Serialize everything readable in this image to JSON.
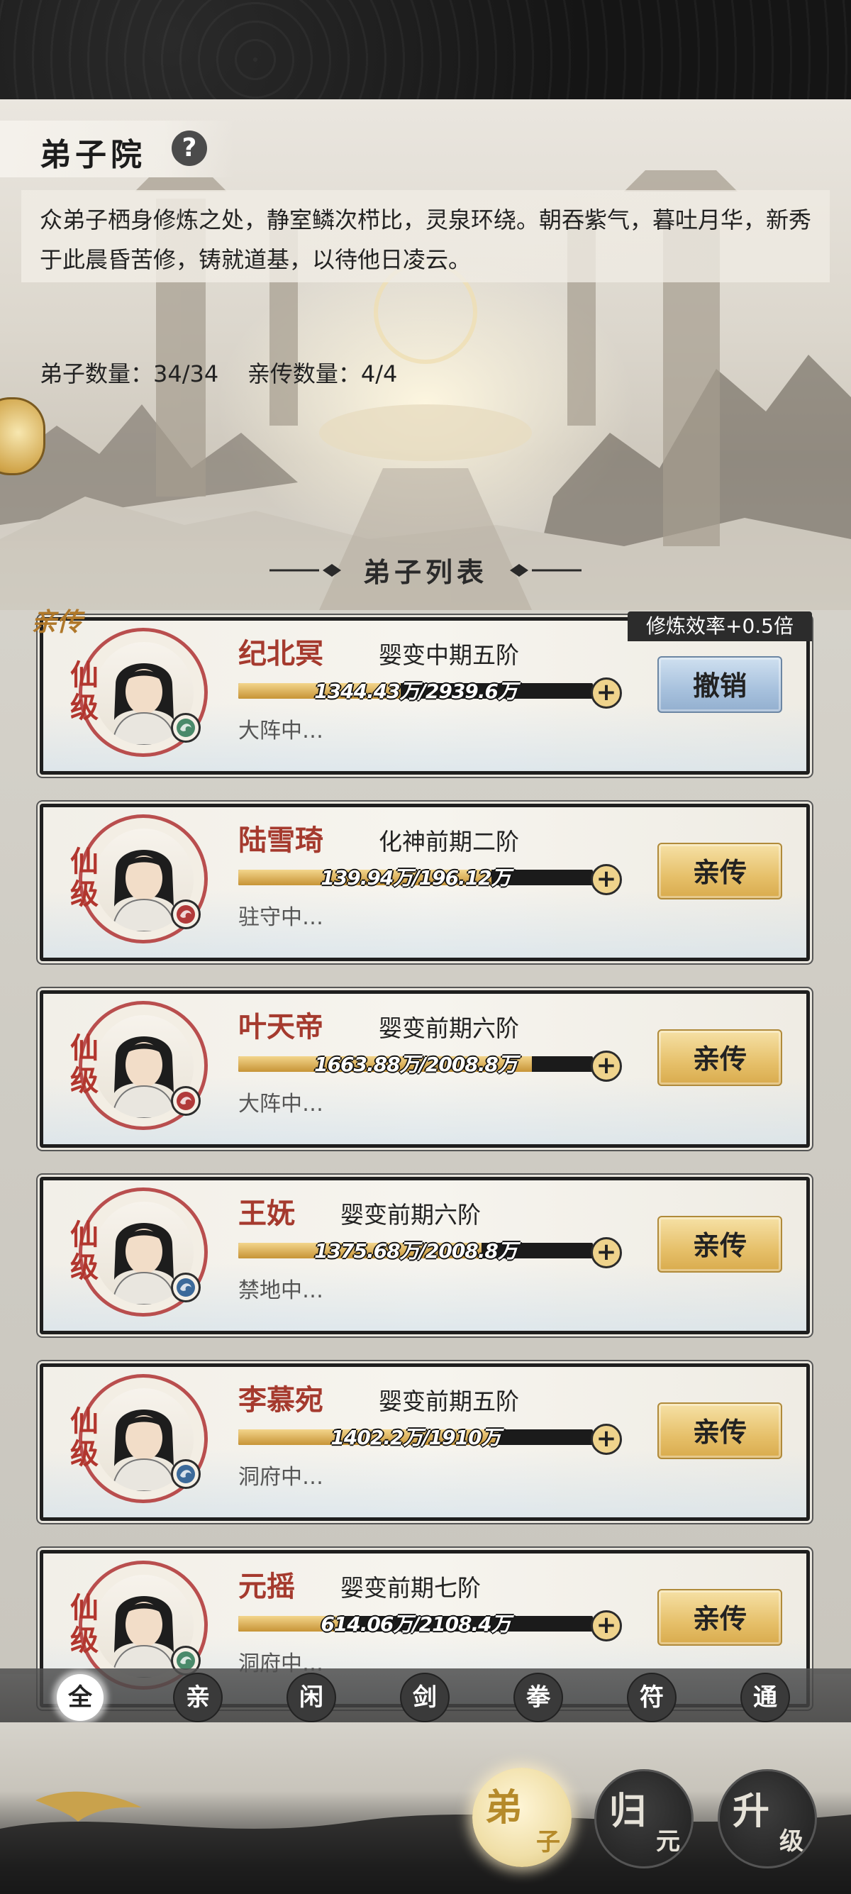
{
  "header": {
    "title": "弟子院",
    "description": "众弟子栖身修炼之处，静室鳞次栉比，灵泉环绕。朝吞紫气，暮吐月华，新秀于此晨昏苦修，铸就道基，以待他日凌云。",
    "counts": "弟子数量：34/34    亲传数量：4/4"
  },
  "list_title": "弟子列表",
  "section_label": "亲传",
  "efficiency_tag": "修炼效率+0.5倍",
  "disciples": [
    {
      "grade": "仙级",
      "name": "纪北冥",
      "realm": "婴变中期五阶",
      "progress": "1344.43万/2939.6万",
      "fill": 0.457,
      "status": "大阵中…",
      "action": "撤销",
      "element": "wind"
    },
    {
      "grade": "仙级",
      "name": "陆雪琦",
      "realm": "化神前期二阶",
      "progress": "139.94万/196.12万",
      "fill": 0.714,
      "status": "驻守中…",
      "action": "亲传",
      "element": "fire"
    },
    {
      "grade": "仙级",
      "name": "叶天帝",
      "realm": "婴变前期六阶",
      "progress": "1663.88万/2008.8万",
      "fill": 0.828,
      "status": "大阵中…",
      "action": "亲传",
      "element": "fire"
    },
    {
      "grade": "仙级",
      "name": "王妩",
      "realm": "婴变前期六阶",
      "progress": "1375.68万/2008.8万",
      "fill": 0.685,
      "status": "禁地中…",
      "action": "亲传",
      "element": "water"
    },
    {
      "grade": "仙级",
      "name": "李慕宛",
      "realm": "婴变前期五阶",
      "progress": "1402.2万/1910万",
      "fill": 0.734,
      "status": "洞府中…",
      "action": "亲传",
      "element": "water"
    },
    {
      "grade": "仙级",
      "name": "元摇",
      "realm": "婴变前期七阶",
      "progress": "614.06万/2108.4万",
      "fill": 0.291,
      "status": "洞府中…",
      "action": "亲传",
      "element": "wind"
    }
  ],
  "filters": [
    "全",
    "亲",
    "闲",
    "剑",
    "拳",
    "符",
    "通"
  ],
  "active_filter": "全",
  "nav": {
    "disciple": {
      "big": "弟",
      "small": "子"
    },
    "return": {
      "big": "归",
      "small": "元"
    },
    "upgrade": {
      "big": "升",
      "small": "级"
    }
  }
}
